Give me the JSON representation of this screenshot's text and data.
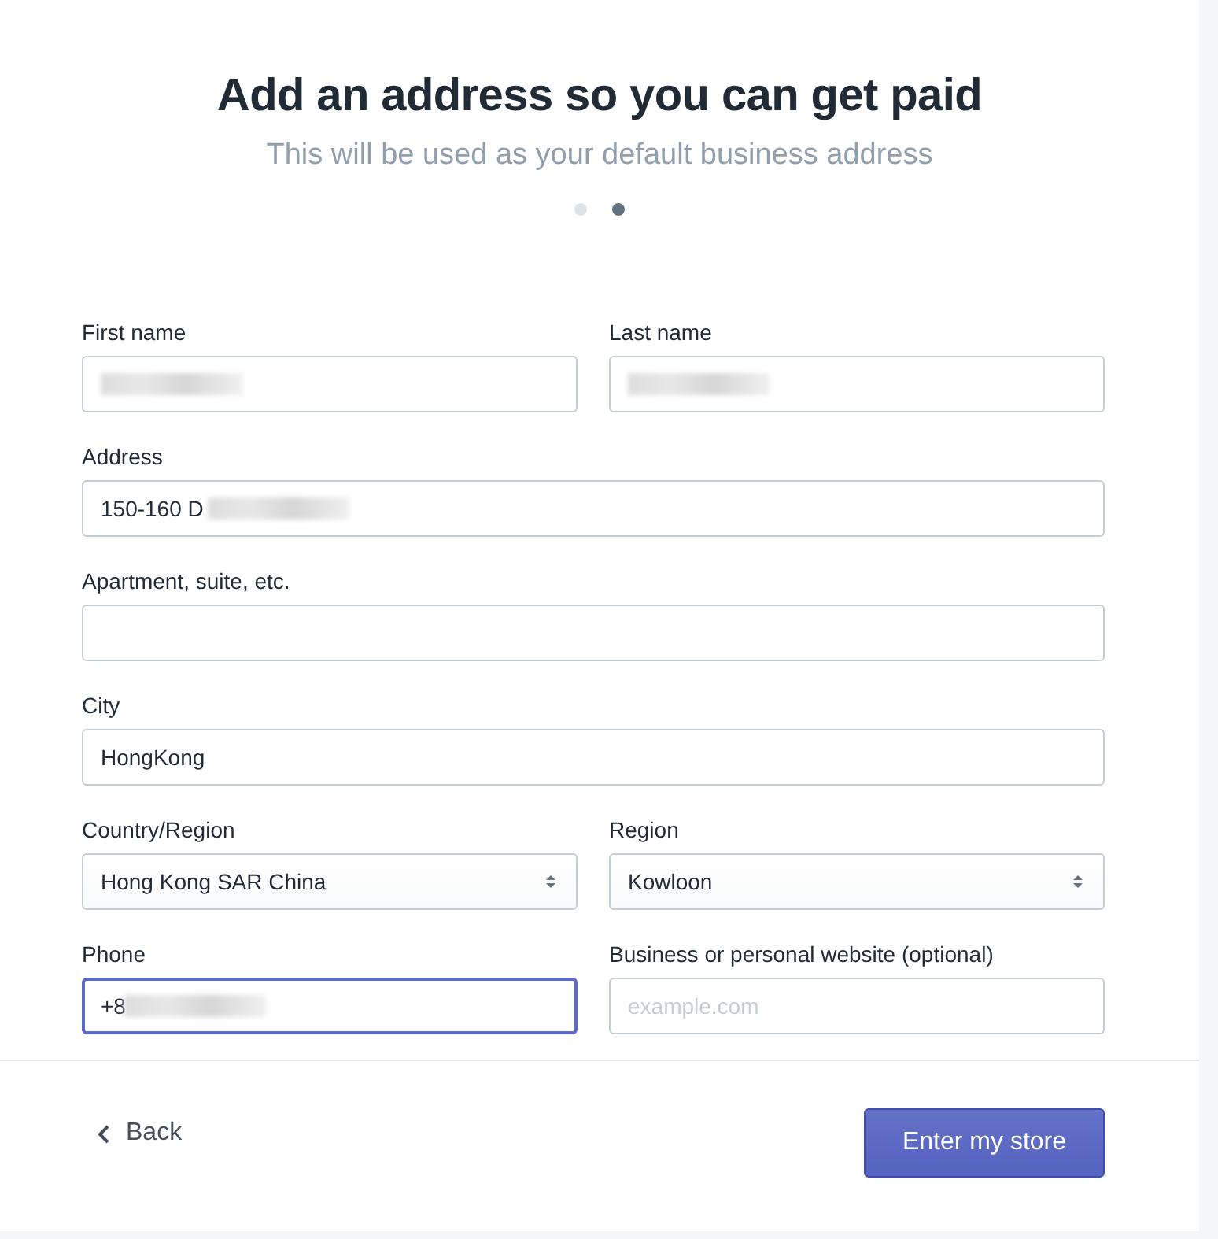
{
  "header": {
    "title": "Add an address so you can get paid",
    "subtitle": "This will be used as your default business address"
  },
  "steps": [
    {
      "selected": false
    },
    {
      "selected": true
    }
  ],
  "form_rows": [
    {
      "fields": [
        {
          "kind": "text",
          "label": "First name",
          "redacted": true,
          "focused": false
        },
        {
          "kind": "text",
          "label": "Last name",
          "redacted": true,
          "focused": false
        }
      ]
    },
    {
      "fields": [
        {
          "kind": "text",
          "label": "Address",
          "value": "150-160 D",
          "redacted": true,
          "focused": false
        }
      ]
    },
    {
      "fields": [
        {
          "kind": "text",
          "label": "Apartment, suite, etc.",
          "focused": false
        }
      ]
    },
    {
      "fields": [
        {
          "kind": "text",
          "label": "City",
          "value": "HongKong",
          "focused": false
        }
      ]
    },
    {
      "fields": [
        {
          "kind": "select",
          "label": "Country/Region",
          "value": "Hong Kong SAR China",
          "focused": false
        },
        {
          "kind": "select",
          "label": "Region",
          "value": "Kowloon",
          "focused": false
        }
      ]
    },
    {
      "fields": [
        {
          "kind": "text",
          "label": "Phone",
          "value": "+8",
          "redacted": true,
          "focused": true
        },
        {
          "kind": "text",
          "label": "Business or personal website (optional)",
          "placeholder": "example.com",
          "focused": false
        }
      ]
    }
  ],
  "footer": {
    "back": "Back",
    "submit": "Enter my store"
  }
}
